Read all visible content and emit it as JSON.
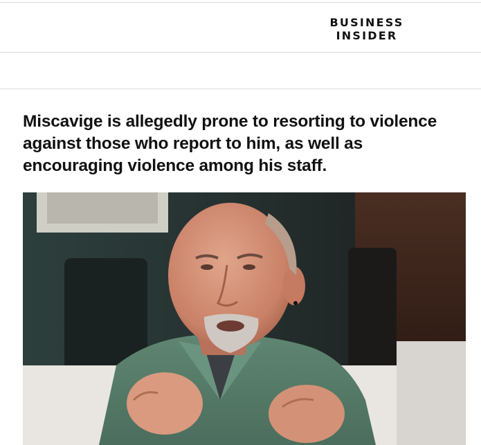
{
  "brand": {
    "line1": "BUSINESS",
    "line2": "INSIDER"
  },
  "article": {
    "headline": "Miscavige is allegedly prone to resorting to violence against those who report to him, as well as encouraging violence among his staff."
  },
  "colors": {
    "background": "#ffffff",
    "text": "#111111",
    "divider": "#d9d9d9"
  }
}
